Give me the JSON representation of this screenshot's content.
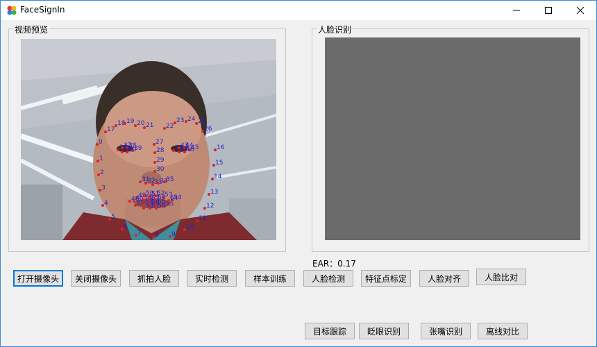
{
  "window": {
    "title": "FaceSignIn"
  },
  "groups": {
    "preview_title": "视频预览",
    "recognition_title": "人脸识别"
  },
  "status": {
    "ear_label": "EAR：0.17"
  },
  "buttons_row1": [
    {
      "label": "打开摄像头"
    },
    {
      "label": "关闭摄像头"
    },
    {
      "label": "抓拍人脸"
    },
    {
      "label": "实时检测"
    },
    {
      "label": "样本训练"
    },
    {
      "label": "人脸检测"
    },
    {
      "label": "特征点标定"
    },
    {
      "label": "人脸对齐"
    },
    {
      "label": "人脸比对"
    }
  ],
  "buttons_row2": [
    {
      "label": "目标跟踪"
    },
    {
      "label": "眨眼识别"
    },
    {
      "label": "张嘴识别"
    },
    {
      "label": "离线对比"
    }
  ],
  "landmarks": [
    "0",
    "1",
    "2",
    "3",
    "4",
    "5",
    "6",
    "7",
    "8",
    "9",
    "10",
    "11",
    "12",
    "13",
    "14",
    "15",
    "16",
    "17",
    "18",
    "19",
    "20",
    "21",
    "22",
    "23",
    "24",
    "25",
    "26",
    "27",
    "28",
    "29",
    "30",
    "31",
    "32",
    "33",
    "34",
    "35",
    "36",
    "37",
    "38",
    "39",
    "40",
    "41",
    "42",
    "43",
    "44",
    "45",
    "46",
    "47",
    "48",
    "49",
    "50",
    "51",
    "52",
    "53",
    "54",
    "55",
    "56",
    "57",
    "58",
    "59",
    "60",
    "61",
    "62",
    "63",
    "64",
    "65",
    "66",
    "67"
  ],
  "colors": {
    "landmark_dot": "#e02020",
    "landmark_text": "#2020d0",
    "recognition_bg": "#6b6b6b"
  },
  "icons": {
    "app": "facesignin-app-icon",
    "minimize": "minimize-icon",
    "maximize": "maximize-icon",
    "close": "close-icon"
  }
}
